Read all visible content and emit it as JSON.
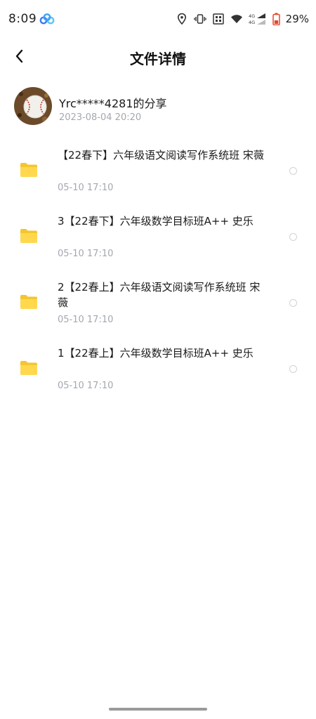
{
  "status_bar": {
    "time": "8:09",
    "battery": "29%",
    "icons": [
      "app-cloud-icon",
      "location-icon",
      "vibrate-icon",
      "nfc-icon",
      "wifi-icon",
      "signal-4g-icon",
      "battery-icon"
    ]
  },
  "header": {
    "title": "文件详情",
    "back_icon": "back-arrow-icon"
  },
  "share": {
    "owner": "Yrc*****4281的分享",
    "date": "2023-08-04  20:20",
    "avatar": "baseball-avatar"
  },
  "files": [
    {
      "name": "【22春下】六年级语文阅读写作系统班  宋薇",
      "date": "05-10  17:10",
      "icon": "folder-icon"
    },
    {
      "name": "3【22春下】六年级数学目标班A++  史乐",
      "date": "05-10  17:10",
      "icon": "folder-icon"
    },
    {
      "name": "2【22春上】六年级语文阅读写作系统班  宋薇",
      "date": "05-10  17:10",
      "icon": "folder-icon"
    },
    {
      "name": "1【22春上】六年级数学目标班A++  史乐",
      "date": "05-10  17:10",
      "icon": "folder-icon"
    }
  ],
  "colors": {
    "folder": "#FFD84D",
    "folder_dark": "#F5C52F",
    "meta_text": "#A3A8B0",
    "battery_accent": "#E8452C"
  }
}
